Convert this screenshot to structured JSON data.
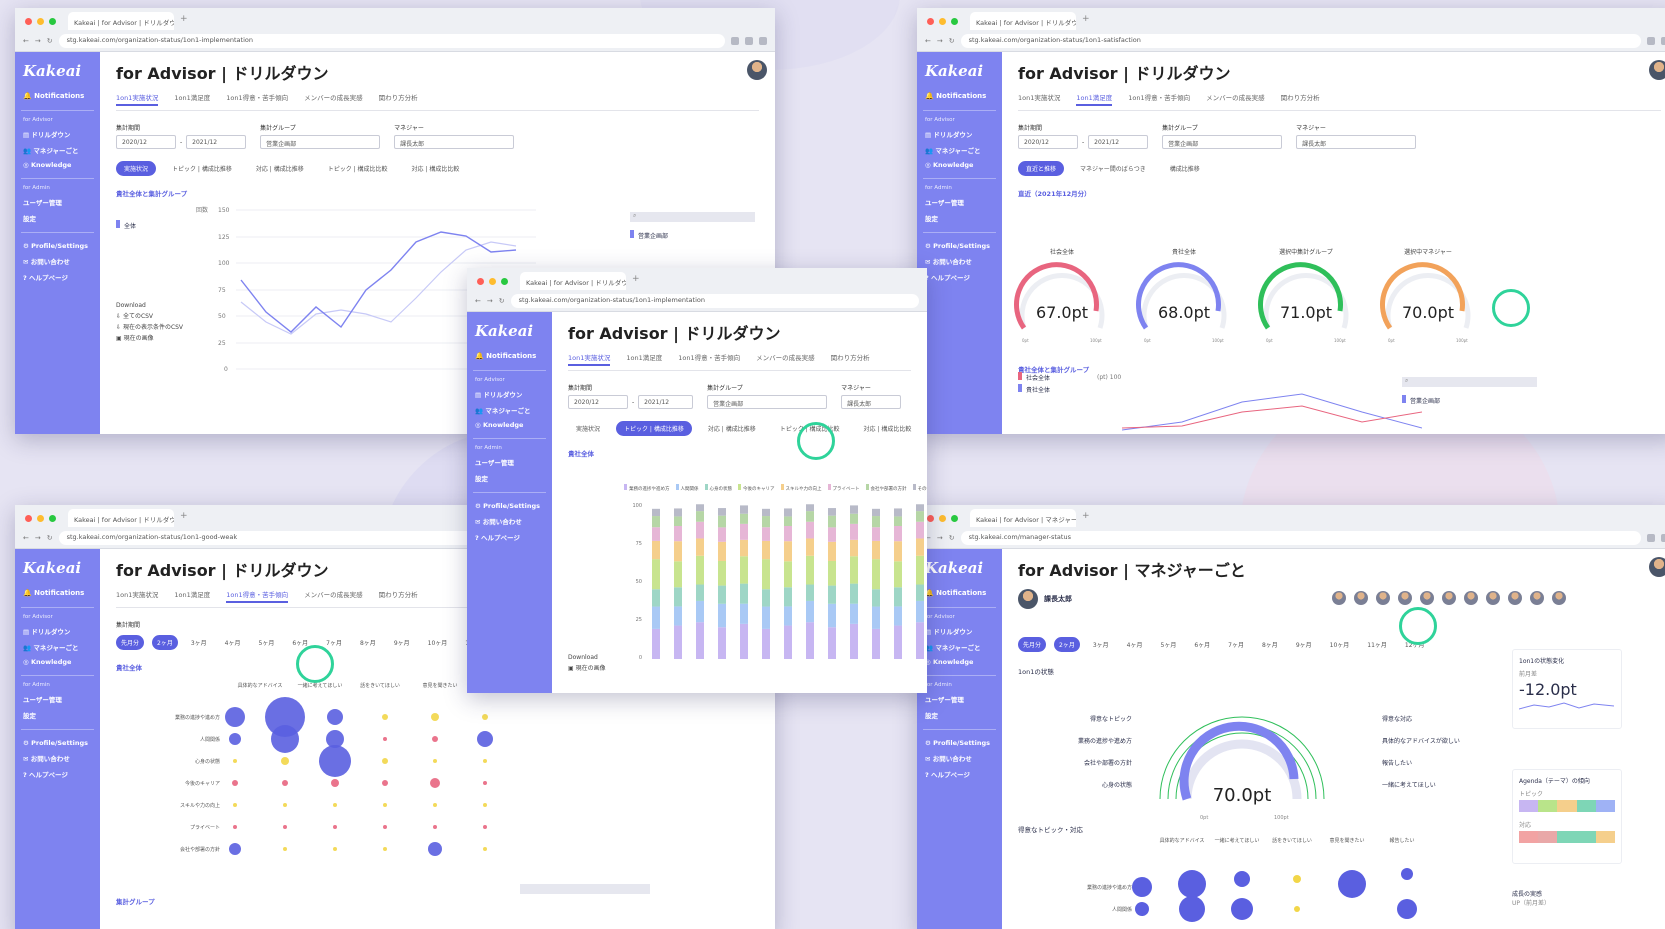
{
  "colors": {
    "sidebar": "#7e83f0",
    "accent": "#5a5fe0",
    "highlight": "#2fd39a"
  },
  "tab_title": "Kakeai | for Advisor | ドリルダウン",
  "tab_title_mgr": "Kakeai | for Advisor | マネジャー",
  "urls": {
    "implementation": "stg.kakeai.com/organization-status/1on1-implementation",
    "satisfaction": "stg.kakeai.com/organization-status/1on1-satisfaction",
    "goodweak": "stg.kakeai.com/organization-status/1on1-good-weak",
    "manager": "stg.kakeai.com/manager-status"
  },
  "sidebar": {
    "logo": "Kakeai",
    "notifications": "Notifications",
    "advisor_section": "for Advisor",
    "drilldown": "ドリルダウン",
    "per_manager": "マネジャーごと",
    "knowledge": "Knowledge",
    "admin_section": "for Admin",
    "user_mgmt": "ユーザー管理",
    "settings": "設定",
    "profile": "Profile/Settings",
    "contact": "お問い合わせ",
    "help": "ヘルプページ"
  },
  "page_title": "for Advisor | ドリルダウン",
  "page_title_mgr": "for Advisor | マネジャーごと",
  "navtabs": [
    "1on1実施状況",
    "1on1満足度",
    "1on1得意・苦手傾向",
    "メンバーの成長実感",
    "関わり方分析"
  ],
  "filters": {
    "period_label": "集計期間",
    "date_from": "2020/12",
    "date_to": "2021/12",
    "group_label": "集計グループ",
    "group_value": "営業企画部",
    "manager_label": "マネジャー",
    "manager_value": "課長太郎"
  },
  "pills_impl": [
    "実施状況",
    "トピック | 構成比推移",
    "対応 | 構成比推移",
    "トピック | 構成比比較",
    "対応 | 構成比比較"
  ],
  "pills_sat": [
    "直近と推移",
    "マネジャー間のばらつき",
    "構成比推移"
  ],
  "months": [
    "先月分",
    "2ヶ月",
    "3ヶ月",
    "4ヶ月",
    "5ヶ月",
    "6ヶ月",
    "7ヶ月",
    "8ヶ月",
    "9ヶ月",
    "10ヶ月",
    "11ヶ月",
    "12ヶ月"
  ],
  "impl": {
    "section": "貴社全体と集計グループ",
    "legend": "全体",
    "ylabel": "回数",
    "yticks": [
      "150",
      "125",
      "100",
      "75",
      "50",
      "25",
      "0"
    ],
    "download": "Download",
    "dl1": "全てのCSV",
    "dl2": "現在の表示条件のCSV",
    "dl3": "現在の画像",
    "search_item": "営業企画部"
  },
  "sat": {
    "section": "直近（2021年12月分）",
    "gauges": [
      {
        "name": "社会全体",
        "value": "67.0pt",
        "color": "#e8657f"
      },
      {
        "name": "貴社全体",
        "value": "68.0pt",
        "color": "#7e83f0"
      },
      {
        "name": "選択中集計グループ",
        "value": "71.0pt",
        "color": "#2fbf5a"
      },
      {
        "name": "選択中マネジャー",
        "value": "70.0pt",
        "color": "#f2a25a"
      }
    ],
    "gmin": "0pt",
    "gmax": "100pt",
    "section2": "貴社全体と集計グループ",
    "leg1": "社会全体",
    "leg2": "貴社全体",
    "search_item": "営業企画部",
    "yunit": "(pt) 100"
  },
  "comp": {
    "section": "貴社全体",
    "legend": [
      "業務の進捗や進め方",
      "人間関係",
      "心身の状態",
      "今後のキャリア",
      "スキルや力の向上",
      "プライベート",
      "会社や部署の方針",
      "その他トピック"
    ],
    "yticks": [
      "100",
      "75",
      "50",
      "25",
      "0"
    ],
    "download": "Download",
    "dl": "現在の画像"
  },
  "gw": {
    "section": "貴社全体",
    "cols": [
      "具体的なアドバイス",
      "一緒に考えてほしい",
      "話をきいてほしい",
      "意見を聞きたい"
    ],
    "rows": [
      "業務の進捗や進め方",
      "人間関係",
      "心身の状態",
      "今後のキャリア",
      "スキルや力の向上",
      "プライベート",
      "会社や部署の方針"
    ],
    "section2": "集計グループ"
  },
  "mgr": {
    "name": "課長太郎",
    "state": "1on1の状態",
    "good_topic": "得意なトピック",
    "good_resp": "得意な対応",
    "topics": [
      "業務の進捗や進め方",
      "会社や部署の方針",
      "心身の状態"
    ],
    "resps": [
      "具体的なアドバイスが欲しい",
      "報告したい",
      "一緒に考えてほしい"
    ],
    "value": "70.0pt",
    "gmin": "0pt",
    "gmax": "100pt",
    "change_title": "1on1の状態変化",
    "change_sub": "前月差",
    "change_value": "-12.0pt",
    "agenda_title": "Agenda（テーマ）の傾向",
    "agenda_topic": "トピック",
    "agenda_resp": "対応",
    "growth": "成長の実感",
    "growth_sub": "UP（前月差）",
    "topic_resp": "得意なトピック・対応",
    "cols": [
      "具体的なアドバイス",
      "一緒に考えてほしい",
      "話をきいてほしい",
      "意見を聞きたい",
      "報告したい"
    ],
    "rows": [
      "業務の進捗や進め方",
      "人間関係"
    ]
  }
}
